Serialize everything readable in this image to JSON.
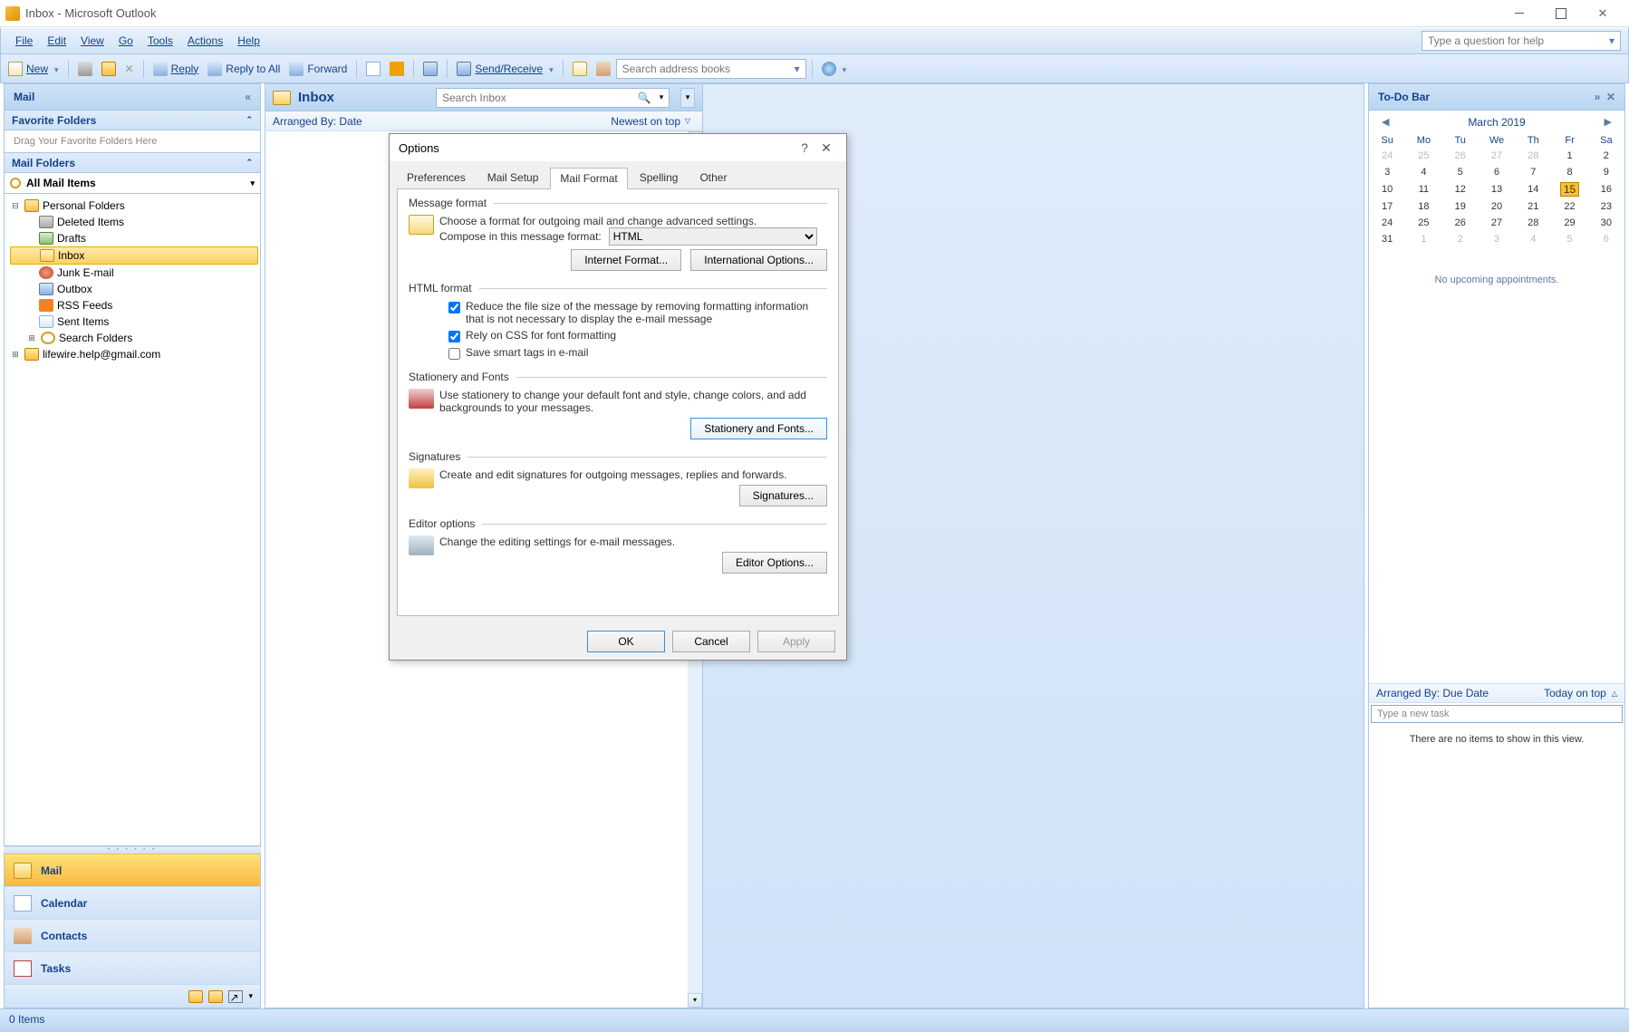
{
  "window": {
    "title": "Inbox - Microsoft Outlook"
  },
  "menus": {
    "file": "File",
    "edit": "Edit",
    "view": "View",
    "go": "Go",
    "tools": "Tools",
    "actions": "Actions",
    "help": "Help"
  },
  "help_box": {
    "placeholder": "Type a question for help"
  },
  "toolbar": {
    "new": "New",
    "reply": "Reply",
    "reply_all": "Reply to All",
    "forward": "Forward",
    "send_receive": "Send/Receive",
    "search_placeholder": "Search address books"
  },
  "nav_pane": {
    "title": "Mail",
    "favorite_header": "Favorite Folders",
    "drag_hint": "Drag Your Favorite Folders Here",
    "mail_folders_header": "Mail Folders",
    "all_mail": "All Mail Items",
    "tree": {
      "personal": "Personal Folders",
      "deleted": "Deleted Items",
      "drafts": "Drafts",
      "inbox": "Inbox",
      "junk": "Junk E-mail",
      "outbox": "Outbox",
      "rss": "RSS Feeds",
      "sent": "Sent Items",
      "search": "Search Folders",
      "gmail": "lifewire.help@gmail.com"
    },
    "buttons": {
      "mail": "Mail",
      "calendar": "Calendar",
      "contacts": "Contacts",
      "tasks": "Tasks"
    }
  },
  "inbox": {
    "title": "Inbox",
    "search_placeholder": "Search Inbox",
    "arranged_by": "Arranged By: Date",
    "sort": "Newest on top"
  },
  "todo": {
    "title": "To-Do Bar",
    "month": "March 2019",
    "dow": [
      "Su",
      "Mo",
      "Tu",
      "We",
      "Th",
      "Fr",
      "Sa"
    ],
    "weeks": [
      [
        {
          "d": "24",
          "dim": true
        },
        {
          "d": "25",
          "dim": true
        },
        {
          "d": "26",
          "dim": true
        },
        {
          "d": "27",
          "dim": true
        },
        {
          "d": "28",
          "dim": true
        },
        {
          "d": "1"
        },
        {
          "d": "2"
        }
      ],
      [
        {
          "d": "3"
        },
        {
          "d": "4"
        },
        {
          "d": "5"
        },
        {
          "d": "6"
        },
        {
          "d": "7"
        },
        {
          "d": "8"
        },
        {
          "d": "9"
        }
      ],
      [
        {
          "d": "10"
        },
        {
          "d": "11"
        },
        {
          "d": "12"
        },
        {
          "d": "13"
        },
        {
          "d": "14"
        },
        {
          "d": "15",
          "today": true
        },
        {
          "d": "16"
        }
      ],
      [
        {
          "d": "17"
        },
        {
          "d": "18"
        },
        {
          "d": "19"
        },
        {
          "d": "20"
        },
        {
          "d": "21"
        },
        {
          "d": "22"
        },
        {
          "d": "23"
        }
      ],
      [
        {
          "d": "24"
        },
        {
          "d": "25"
        },
        {
          "d": "26"
        },
        {
          "d": "27"
        },
        {
          "d": "28"
        },
        {
          "d": "29"
        },
        {
          "d": "30"
        }
      ],
      [
        {
          "d": "31"
        },
        {
          "d": "1",
          "dim": true
        },
        {
          "d": "2",
          "dim": true
        },
        {
          "d": "3",
          "dim": true
        },
        {
          "d": "4",
          "dim": true
        },
        {
          "d": "5",
          "dim": true
        },
        {
          "d": "6",
          "dim": true
        }
      ]
    ],
    "no_appt": "No upcoming appointments.",
    "task_arranged": "Arranged By: Due Date",
    "task_sort": "Today on top",
    "new_task_placeholder": "Type a new task",
    "no_items": "There are no items to show in this view."
  },
  "status": {
    "items": "0 Items"
  },
  "dialog": {
    "title": "Options",
    "tabs": {
      "preferences": "Preferences",
      "mail_setup": "Mail Setup",
      "mail_format": "Mail Format",
      "spelling": "Spelling",
      "other": "Other"
    },
    "msg_format": {
      "legend": "Message format",
      "desc": "Choose a format for outgoing mail and change advanced settings.",
      "compose_label": "Compose in this message format:",
      "compose_value": "HTML",
      "internet": "Internet Format...",
      "international": "International Options..."
    },
    "html_format": {
      "legend": "HTML format",
      "reduce": "Reduce the file size of the message by removing formatting information that is not necessary to display the e-mail message",
      "css": "Rely on CSS for font formatting",
      "smart": "Save smart tags in e-mail"
    },
    "stationery": {
      "legend": "Stationery and Fonts",
      "desc": "Use stationery to change your default font and style, change colors, and add backgrounds to your messages.",
      "btn": "Stationery and Fonts..."
    },
    "signatures": {
      "legend": "Signatures",
      "desc": "Create and edit signatures for outgoing messages, replies and forwards.",
      "btn": "Signatures..."
    },
    "editor": {
      "legend": "Editor options",
      "desc": "Change the editing settings for e-mail messages.",
      "btn": "Editor Options..."
    },
    "buttons": {
      "ok": "OK",
      "cancel": "Cancel",
      "apply": "Apply"
    }
  }
}
